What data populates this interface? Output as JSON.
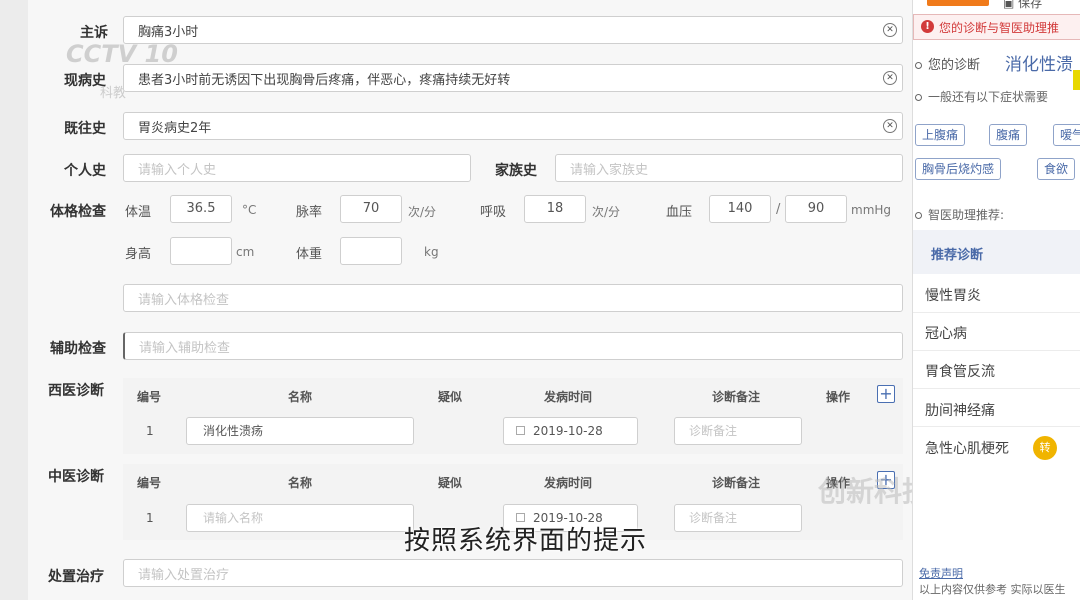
{
  "watermarks": {
    "channel": "CCTV 10",
    "channel_sub": "科教",
    "program": "创新科技"
  },
  "form": {
    "chief_complaint": {
      "label": "主诉",
      "value": "胸痛3小时"
    },
    "present_illness": {
      "label": "现病史",
      "value": "患者3小时前无诱因下出现胸骨后疼痛，伴恶心，疼痛持续无好转"
    },
    "past_history": {
      "label": "既往史",
      "value": "胃炎病史2年"
    },
    "personal_history": {
      "label": "个人史",
      "placeholder": "请输入个人史"
    },
    "family_history": {
      "label": "家族史",
      "placeholder": "请输入家族史"
    },
    "physical_exam": {
      "label": "体格检查",
      "temp_label": "体温",
      "temp_value": "36.5",
      "temp_unit": "°C",
      "pulse_label": "脉率",
      "pulse_value": "70",
      "pulse_unit": "次/分",
      "resp_label": "呼吸",
      "resp_value": "18",
      "resp_unit": "次/分",
      "bp_label": "血压",
      "bp_sys": "140",
      "bp_sep": "/",
      "bp_dia": "90",
      "bp_unit": "mmHg",
      "height_label": "身高",
      "height_unit": "cm",
      "weight_label": "体重",
      "weight_unit": "kg",
      "notes_placeholder": "请输入体格检查"
    },
    "aux_exam": {
      "label": "辅助检查",
      "placeholder": "请输入辅助检查"
    },
    "western_dx": {
      "label": "西医诊断",
      "headers": {
        "no": "编号",
        "name": "名称",
        "suspect": "疑似",
        "onset": "发病时间",
        "remark": "诊断备注",
        "action": "操作"
      },
      "row": {
        "no": "1",
        "name": "消化性溃疡",
        "onset": "2019-10-28",
        "remark_placeholder": "诊断备注"
      }
    },
    "tcm_dx": {
      "label": "中医诊断",
      "headers": {
        "no": "编号",
        "name": "名称",
        "suspect": "疑似",
        "onset": "发病时间",
        "remark": "诊断备注",
        "action": "操作"
      },
      "row": {
        "no": "1",
        "name_placeholder": "请输入名称",
        "onset": "2019-10-28",
        "remark_placeholder": "诊断备注"
      }
    },
    "treatment": {
      "label": "处置治疗",
      "placeholder": "请输入处置治疗"
    }
  },
  "subtitle": "按照系统界面的提示",
  "sidebar": {
    "save_label": "保存",
    "warning": "您的诊断与智医助理推",
    "hint1": "您的诊断",
    "hint1_highlight": "消化性溃",
    "hint2": "一般还有以下症状需要",
    "symptom_tags": [
      "上腹痛",
      "腹痛",
      "嗳气",
      "胸骨后烧灼感",
      "食欲"
    ],
    "assistant_label": "智医助理推荐:",
    "recommend_header": "推荐诊断",
    "recommendations": [
      "慢性胃炎",
      "冠心病",
      "胃食管反流",
      "肋间神经痛",
      "急性心肌梗死"
    ],
    "badge": "转",
    "disclaimer_link": "免责声明",
    "disclaimer_text": "以上内容仅供参考 实际以医生"
  },
  "colors": {
    "accent": "#4a6fb2",
    "warning": "#d23a3a",
    "badge": "#f0b400",
    "save": "#f07a1a"
  }
}
